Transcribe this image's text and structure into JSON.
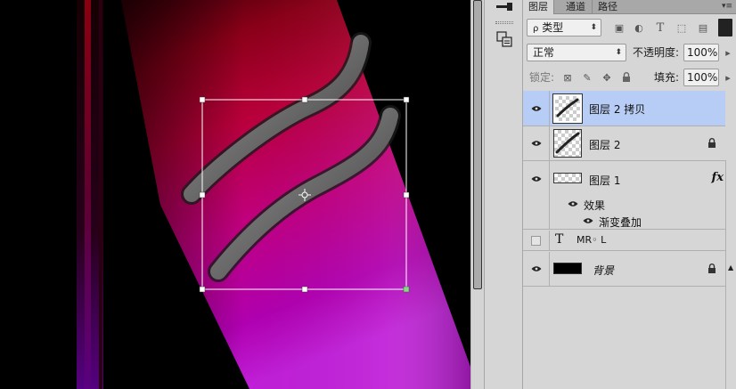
{
  "panel": {
    "tabs": [
      {
        "label": "图层",
        "active": true
      },
      {
        "label": "通道",
        "active": false
      },
      {
        "label": "路径",
        "active": false
      }
    ],
    "filter_kind": "类型",
    "blend_mode": "正常",
    "opacity_label": "不透明度:",
    "opacity_value": "100%",
    "lock_label": "锁定:",
    "fill_label": "填充:",
    "fill_value": "100%"
  },
  "layers": [
    {
      "name": "图层 2 拷贝",
      "visible": true,
      "selected": true,
      "locked": false
    },
    {
      "name": "图层 2",
      "visible": true,
      "selected": false,
      "locked": true
    },
    {
      "name": "图层 1",
      "visible": true,
      "selected": false,
      "locked": false,
      "fx": "fx"
    },
    {
      "name": "效果",
      "kind": "effects-group",
      "visible": true
    },
    {
      "name": "渐变叠加",
      "kind": "effect",
      "visible": true
    },
    {
      "name": "MR◦ L",
      "kind": "text",
      "visible": false,
      "type_glyph": "T"
    },
    {
      "name": "背景",
      "visible": true,
      "locked": true,
      "italic": true
    }
  ],
  "colors": {
    "selected_row": "#b8cdf6",
    "panel_bg": "#d6d6d6",
    "canvas_bg": "#000000",
    "ribbon_red": "#a0002a",
    "ribbon_magenta": "#c000b0",
    "transform_handle": "#ffffff"
  }
}
